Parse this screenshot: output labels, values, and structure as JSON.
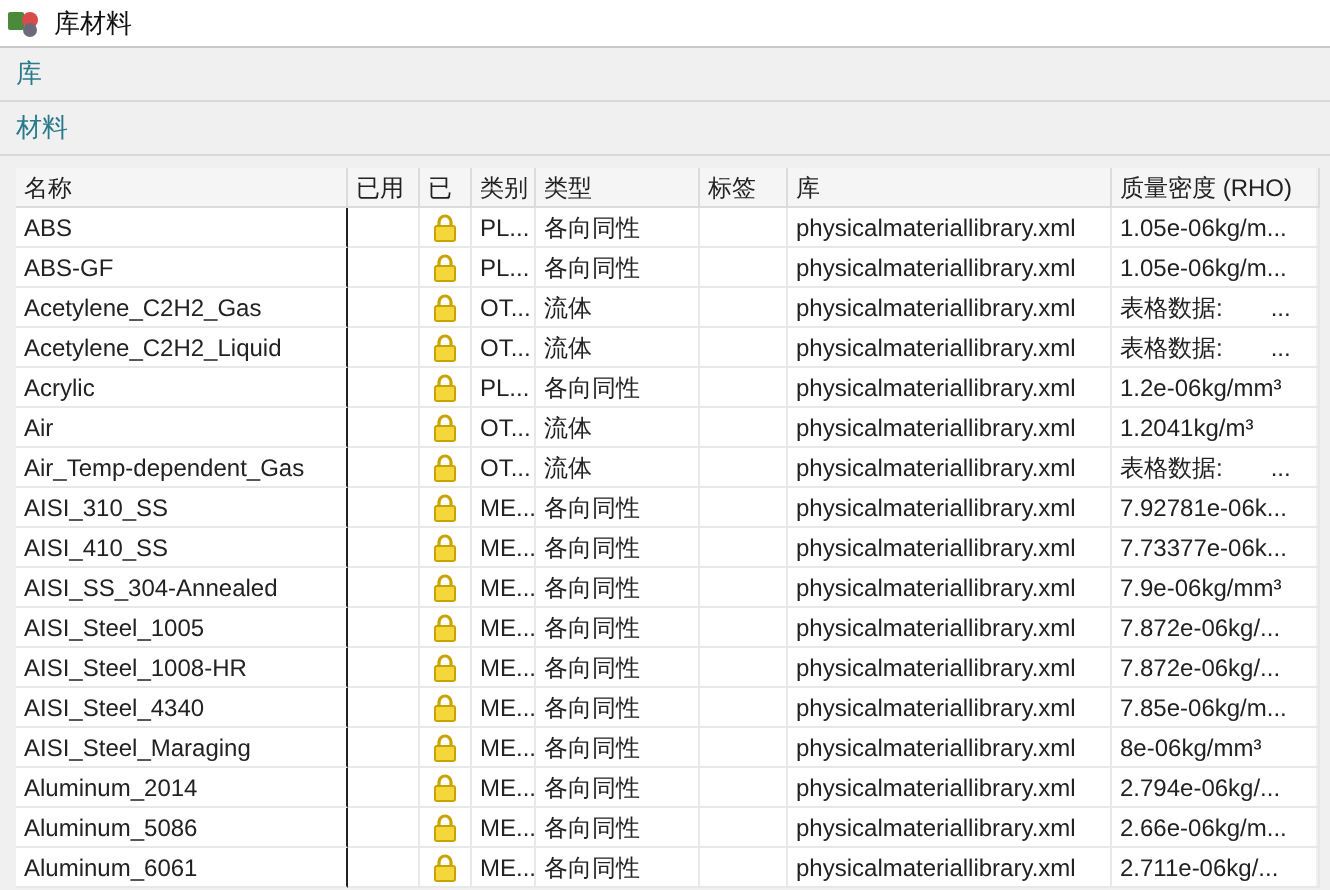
{
  "window": {
    "title": "库材料"
  },
  "sections": [
    {
      "label": "库"
    },
    {
      "label": "材料"
    }
  ],
  "table": {
    "columns": [
      "名称",
      "已用",
      "已",
      "类别",
      "类型",
      "标签",
      "库",
      "质量密度 (RHO)"
    ],
    "rows": [
      {
        "name": "ABS",
        "locked": true,
        "category": "PL...",
        "type": "各向同性",
        "library": "physicalmateriallibrary.xml",
        "density": "1.05e-06kg/m..."
      },
      {
        "name": "ABS-GF",
        "locked": true,
        "category": "PL...",
        "type": "各向同性",
        "library": "physicalmateriallibrary.xml",
        "density": "1.05e-06kg/m..."
      },
      {
        "name": "Acetylene_C2H2_Gas",
        "locked": true,
        "category": "OT...",
        "type": "流体",
        "library": "physicalmateriallibrary.xml",
        "density": "表格数据:　　..."
      },
      {
        "name": "Acetylene_C2H2_Liquid",
        "locked": true,
        "category": "OT...",
        "type": "流体",
        "library": "physicalmateriallibrary.xml",
        "density": "表格数据:　　..."
      },
      {
        "name": "Acrylic",
        "locked": true,
        "category": "PL...",
        "type": "各向同性",
        "library": "physicalmateriallibrary.xml",
        "density": "1.2e-06kg/mm³"
      },
      {
        "name": "Air",
        "locked": true,
        "category": "OT...",
        "type": "流体",
        "library": "physicalmateriallibrary.xml",
        "density": "1.2041kg/m³"
      },
      {
        "name": "Air_Temp-dependent_Gas",
        "locked": true,
        "category": "OT...",
        "type": "流体",
        "library": "physicalmateriallibrary.xml",
        "density": "表格数据:　　..."
      },
      {
        "name": "AISI_310_SS",
        "locked": true,
        "category": "ME...",
        "type": "各向同性",
        "library": "physicalmateriallibrary.xml",
        "density": "7.92781e-06k..."
      },
      {
        "name": "AISI_410_SS",
        "locked": true,
        "category": "ME...",
        "type": "各向同性",
        "library": "physicalmateriallibrary.xml",
        "density": "7.73377e-06k..."
      },
      {
        "name": "AISI_SS_304-Annealed",
        "locked": true,
        "category": "ME...",
        "type": "各向同性",
        "library": "physicalmateriallibrary.xml",
        "density": "7.9e-06kg/mm³"
      },
      {
        "name": "AISI_Steel_1005",
        "locked": true,
        "category": "ME...",
        "type": "各向同性",
        "library": "physicalmateriallibrary.xml",
        "density": "7.872e-06kg/..."
      },
      {
        "name": "AISI_Steel_1008-HR",
        "locked": true,
        "category": "ME...",
        "type": "各向同性",
        "library": "physicalmateriallibrary.xml",
        "density": "7.872e-06kg/..."
      },
      {
        "name": "AISI_Steel_4340",
        "locked": true,
        "category": "ME...",
        "type": "各向同性",
        "library": "physicalmateriallibrary.xml",
        "density": "7.85e-06kg/m..."
      },
      {
        "name": "AISI_Steel_Maraging",
        "locked": true,
        "category": "ME...",
        "type": "各向同性",
        "library": "physicalmateriallibrary.xml",
        "density": "8e-06kg/mm³"
      },
      {
        "name": "Aluminum_2014",
        "locked": true,
        "category": "ME...",
        "type": "各向同性",
        "library": "physicalmateriallibrary.xml",
        "density": "2.794e-06kg/..."
      },
      {
        "name": "Aluminum_5086",
        "locked": true,
        "category": "ME...",
        "type": "各向同性",
        "library": "physicalmateriallibrary.xml",
        "density": "2.66e-06kg/m..."
      },
      {
        "name": "Aluminum_6061",
        "locked": true,
        "category": "ME...",
        "type": "各向同性",
        "library": "physicalmateriallibrary.xml",
        "density": "2.711e-06kg/..."
      }
    ]
  }
}
